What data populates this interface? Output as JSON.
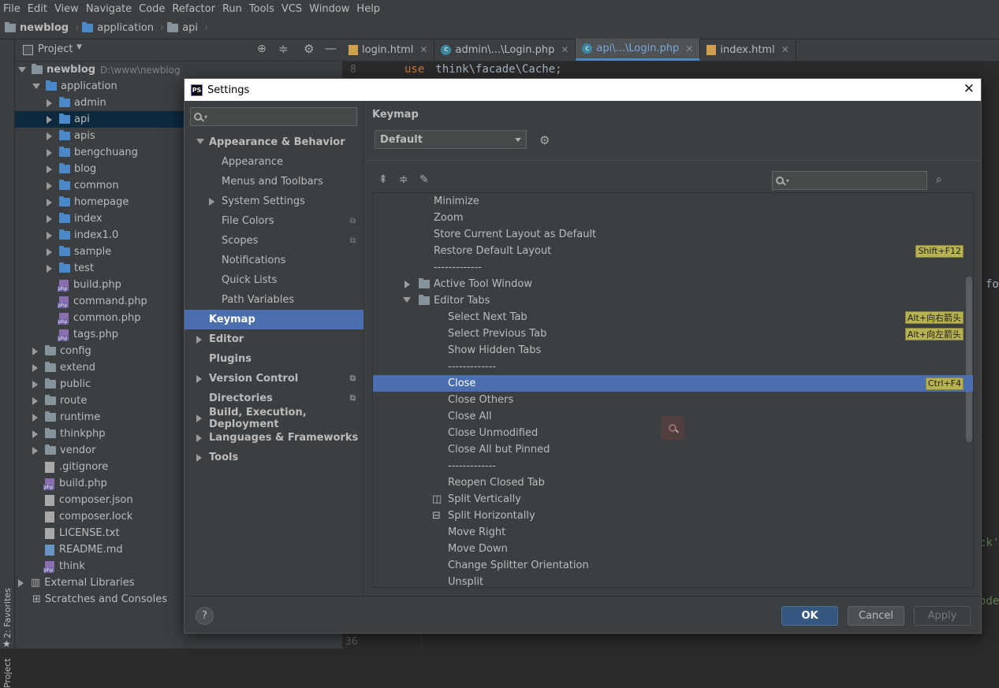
{
  "menu": [
    "File",
    "Edit",
    "View",
    "Navigate",
    "Code",
    "Refactor",
    "Run",
    "Tools",
    "VCS",
    "Window",
    "Help"
  ],
  "breadcrumb": [
    "newblog",
    "application",
    "api"
  ],
  "project_panel": {
    "title": "Project",
    "root": {
      "name": "newblog",
      "path": "D:\\www\\newblog"
    },
    "tree": [
      {
        "label": "application",
        "depth": 1,
        "kind": "folder-open"
      },
      {
        "label": "admin",
        "depth": 2,
        "kind": "folder"
      },
      {
        "label": "api",
        "depth": 2,
        "kind": "folder",
        "selected": true
      },
      {
        "label": "apis",
        "depth": 2,
        "kind": "folder"
      },
      {
        "label": "bengchuang",
        "depth": 2,
        "kind": "folder"
      },
      {
        "label": "blog",
        "depth": 2,
        "kind": "folder"
      },
      {
        "label": "common",
        "depth": 2,
        "kind": "folder"
      },
      {
        "label": "homepage",
        "depth": 2,
        "kind": "folder"
      },
      {
        "label": "index",
        "depth": 2,
        "kind": "folder"
      },
      {
        "label": "index1.0",
        "depth": 2,
        "kind": "folder"
      },
      {
        "label": "sample",
        "depth": 2,
        "kind": "folder"
      },
      {
        "label": "test",
        "depth": 2,
        "kind": "folder"
      },
      {
        "label": "build.php",
        "depth": 2,
        "kind": "php"
      },
      {
        "label": "command.php",
        "depth": 2,
        "kind": "php"
      },
      {
        "label": "common.php",
        "depth": 2,
        "kind": "php"
      },
      {
        "label": "tags.php",
        "depth": 2,
        "kind": "php"
      },
      {
        "label": "config",
        "depth": 1,
        "kind": "folder"
      },
      {
        "label": "extend",
        "depth": 1,
        "kind": "folder"
      },
      {
        "label": "public",
        "depth": 1,
        "kind": "folder"
      },
      {
        "label": "route",
        "depth": 1,
        "kind": "folder"
      },
      {
        "label": "runtime",
        "depth": 1,
        "kind": "folder"
      },
      {
        "label": "thinkphp",
        "depth": 1,
        "kind": "folder"
      },
      {
        "label": "vendor",
        "depth": 1,
        "kind": "folder"
      },
      {
        "label": ".gitignore",
        "depth": 1,
        "kind": "txt"
      },
      {
        "label": "build.php",
        "depth": 1,
        "kind": "php"
      },
      {
        "label": "composer.json",
        "depth": 1,
        "kind": "txt"
      },
      {
        "label": "composer.lock",
        "depth": 1,
        "kind": "txt"
      },
      {
        "label": "LICENSE.txt",
        "depth": 1,
        "kind": "txt"
      },
      {
        "label": "README.md",
        "depth": 1,
        "kind": "md"
      },
      {
        "label": "think",
        "depth": 1,
        "kind": "php"
      }
    ],
    "extra": [
      "External Libraries",
      "Scratches and Consoles"
    ]
  },
  "side_stripe": [
    "2: Favorites",
    "Project"
  ],
  "editor_tabs": [
    {
      "label": "login.html",
      "type": "html"
    },
    {
      "label": "admin\\...\\Login.php",
      "type": "class"
    },
    {
      "label": "api\\...\\Login.php",
      "type": "class",
      "active": true
    },
    {
      "label": "index.html",
      "type": "html"
    }
  ],
  "editor": {
    "first_line_no": "8",
    "first_line_code": [
      "use",
      " think\\facade\\Cache;"
    ],
    "last_line_no": "36",
    "edge_fragments": [
      "fo",
      "ck'",
      "ode"
    ]
  },
  "dialog": {
    "title": "Settings",
    "nav": [
      {
        "label": "Appearance & Behavior",
        "level": 0,
        "bold": true,
        "arrow": "down"
      },
      {
        "label": "Appearance",
        "level": 1
      },
      {
        "label": "Menus and Toolbars",
        "level": 1
      },
      {
        "label": "System Settings",
        "level": 1,
        "arrow": "right"
      },
      {
        "label": "File Colors",
        "level": 1,
        "indicator": true
      },
      {
        "label": "Scopes",
        "level": 1,
        "indicator": true
      },
      {
        "label": "Notifications",
        "level": 1
      },
      {
        "label": "Quick Lists",
        "level": 1
      },
      {
        "label": "Path Variables",
        "level": 1
      },
      {
        "label": "Keymap",
        "level": 0,
        "bold": true,
        "selected": true
      },
      {
        "label": "Editor",
        "level": 0,
        "bold": true,
        "arrow": "right"
      },
      {
        "label": "Plugins",
        "level": 0,
        "bold": true
      },
      {
        "label": "Version Control",
        "level": 0,
        "bold": true,
        "arrow": "right",
        "indicator": true
      },
      {
        "label": "Directories",
        "level": 0,
        "bold": true,
        "indicator": true
      },
      {
        "label": "Build, Execution, Deployment",
        "level": 0,
        "bold": true,
        "arrow": "right"
      },
      {
        "label": "Languages & Frameworks",
        "level": 0,
        "bold": true,
        "arrow": "right"
      },
      {
        "label": "Tools",
        "level": 0,
        "bold": true,
        "arrow": "right"
      }
    ],
    "section_title": "Keymap",
    "keymap_selected": "Default",
    "actions": [
      {
        "label": "Minimize",
        "indent": 2
      },
      {
        "label": "Zoom",
        "indent": 2
      },
      {
        "label": "Store Current Layout as Default",
        "indent": 2
      },
      {
        "label": "Restore Default Layout",
        "indent": 2,
        "shortcut": "Shift+F12"
      },
      {
        "label": "-------------",
        "indent": 2
      },
      {
        "label": "Active Tool Window",
        "indent": 1,
        "folder": true,
        "arrow": "right"
      },
      {
        "label": "Editor Tabs",
        "indent": 1,
        "folder": true,
        "arrow": "down"
      },
      {
        "label": "Select Next Tab",
        "indent": 3,
        "shortcut": "Alt+向右箭头"
      },
      {
        "label": "Select Previous Tab",
        "indent": 3,
        "shortcut": "Alt+向左箭头"
      },
      {
        "label": "Show Hidden Tabs",
        "indent": 3
      },
      {
        "label": "-------------",
        "indent": 3
      },
      {
        "label": "Close",
        "indent": 3,
        "shortcut": "Ctrl+F4",
        "selected": true
      },
      {
        "label": "Close Others",
        "indent": 3
      },
      {
        "label": "Close All",
        "indent": 3
      },
      {
        "label": "Close Unmodified",
        "indent": 3
      },
      {
        "label": "Close All but Pinned",
        "indent": 3
      },
      {
        "label": "-------------",
        "indent": 3
      },
      {
        "label": "Reopen Closed Tab",
        "indent": 3
      },
      {
        "label": "Split Vertically",
        "indent": 3,
        "icon": "split-vertical-icon"
      },
      {
        "label": "Split Horizontally",
        "indent": 3,
        "icon": "split-horizontal-icon"
      },
      {
        "label": "Move Right",
        "indent": 3
      },
      {
        "label": "Move Down",
        "indent": 3
      },
      {
        "label": "Change Splitter Orientation",
        "indent": 3
      },
      {
        "label": "Unsplit",
        "indent": 3
      }
    ],
    "buttons": {
      "help": "?",
      "ok": "OK",
      "cancel": "Cancel",
      "apply": "Apply"
    }
  },
  "colors": {
    "selection": "#4b6eaf",
    "shortcut_badge": "#b6b151",
    "keyword": "#cc7832",
    "primary_button": "#365880"
  }
}
